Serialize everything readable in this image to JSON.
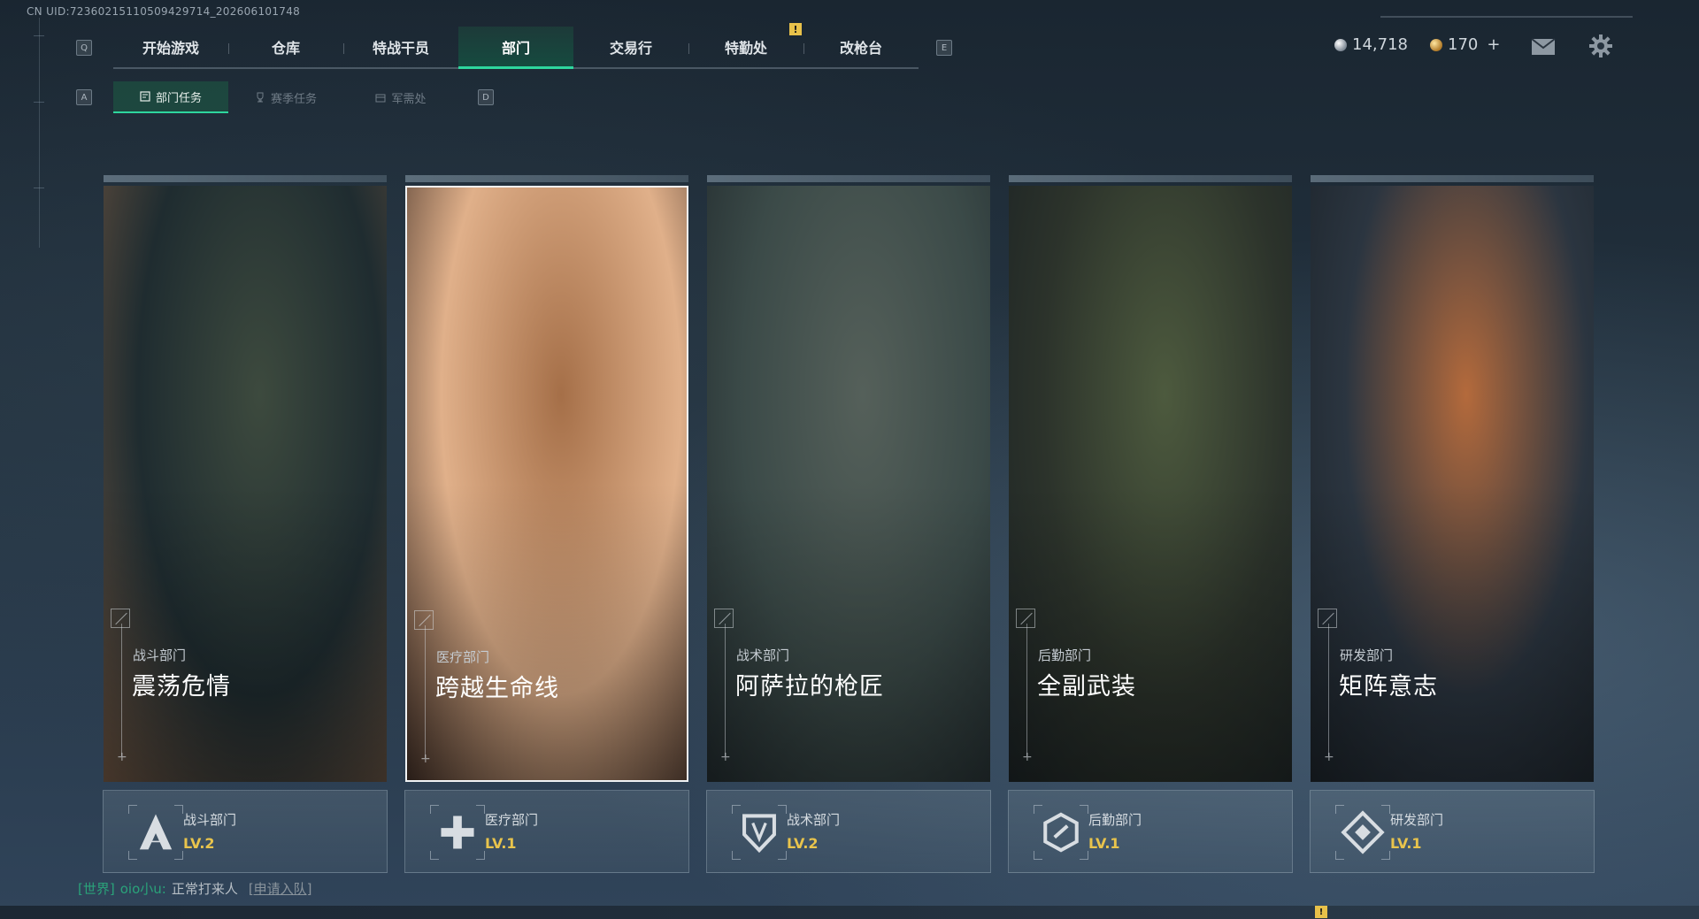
{
  "header": {
    "uid": "CN UID:72360215110509429714_202606101748"
  },
  "topnav": {
    "key_left": "Q",
    "key_right": "E",
    "tabs": [
      {
        "label": "开始游戏"
      },
      {
        "label": "仓库"
      },
      {
        "label": "特战干员"
      },
      {
        "label": "部门",
        "active": true
      },
      {
        "label": "交易行"
      },
      {
        "label": "特勤处"
      },
      {
        "label": "改枪台"
      }
    ],
    "warn": "!"
  },
  "subnav": {
    "key_left": "A",
    "key_right": "D",
    "tabs": [
      {
        "label": "部门任务",
        "active": true
      },
      {
        "label": "赛季任务"
      },
      {
        "label": "军需处"
      }
    ]
  },
  "currency": {
    "silver": "14,718",
    "gold": "170",
    "gold_add": "+"
  },
  "cards": [
    {
      "sub": "战斗部门",
      "title": "震荡危情",
      "dept": "战斗部门",
      "level": "LV.2",
      "emblem": "combat-a-emblem-icon",
      "palette": [
        "#1f2c30",
        "#3d4a3e",
        "#6a5240"
      ]
    },
    {
      "sub": "医疗部门",
      "title": "跨越生命线",
      "dept": "医疗部门",
      "level": "LV.1",
      "emblem": "medical-cross-emblem-icon",
      "palette": [
        "#e0b08a",
        "#a56f48",
        "#3d2c24"
      ],
      "selected": true
    },
    {
      "sub": "战术部门",
      "title": "阿萨拉的枪匠",
      "dept": "战术部门",
      "level": "LV.2",
      "emblem": "tactical-shield-emblem-icon",
      "palette": [
        "#3b4a48",
        "#55605a",
        "#20292c"
      ]
    },
    {
      "sub": "后勤部门",
      "title": "全副武装",
      "dept": "后勤部门",
      "level": "LV.1",
      "emblem": "logistics-hex-emblem-icon",
      "palette": [
        "#2c332b",
        "#4d5a3e",
        "#1b2224"
      ]
    },
    {
      "sub": "研发部门",
      "title": "矩阵意志",
      "dept": "研发部门",
      "level": "LV.1",
      "emblem": "research-diamond-emblem-icon",
      "palette": [
        "#2b3540",
        "#b46a3c",
        "#1b2228"
      ]
    }
  ],
  "chat": {
    "channel": "[世界]",
    "user": "oio小u:",
    "message": "正常打来人",
    "join": "[申请入队]"
  },
  "bottom": {
    "warn": "!"
  }
}
